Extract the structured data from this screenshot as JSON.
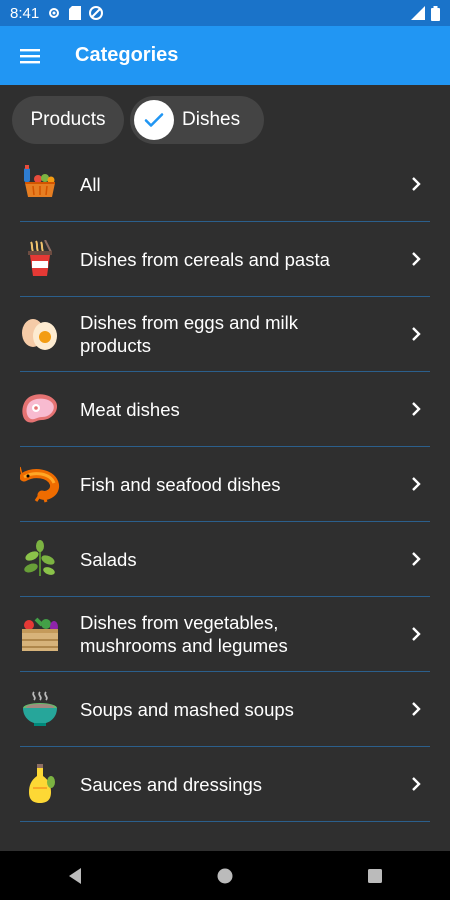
{
  "status": {
    "time": "8:41"
  },
  "appbar": {
    "title": "Categories"
  },
  "chips": [
    {
      "label": "Products",
      "selected": false
    },
    {
      "label": "Dishes",
      "selected": true
    }
  ],
  "categories": [
    {
      "label": "All",
      "icon": "grocery-basket-icon"
    },
    {
      "label": "Dishes from cereals and pasta",
      "icon": "noodle-cup-icon"
    },
    {
      "label": "Dishes from eggs and milk products",
      "icon": "eggs-icon"
    },
    {
      "label": "Meat dishes",
      "icon": "steak-icon"
    },
    {
      "label": "Fish and seafood dishes",
      "icon": "shrimp-icon"
    },
    {
      "label": "Salads",
      "icon": "herb-leaves-icon"
    },
    {
      "label": "Dishes from vegetables, mushrooms and legumes",
      "icon": "vegetable-crate-icon"
    },
    {
      "label": "Soups and mashed soups",
      "icon": "soup-bowl-icon"
    },
    {
      "label": "Sauces and dressings",
      "icon": "oil-bottle-icon"
    }
  ],
  "colors": {
    "appbar": "#2196f3",
    "statusbar": "#1a73c9",
    "background": "#2f2f2f",
    "divider": "#2b5f8c"
  }
}
